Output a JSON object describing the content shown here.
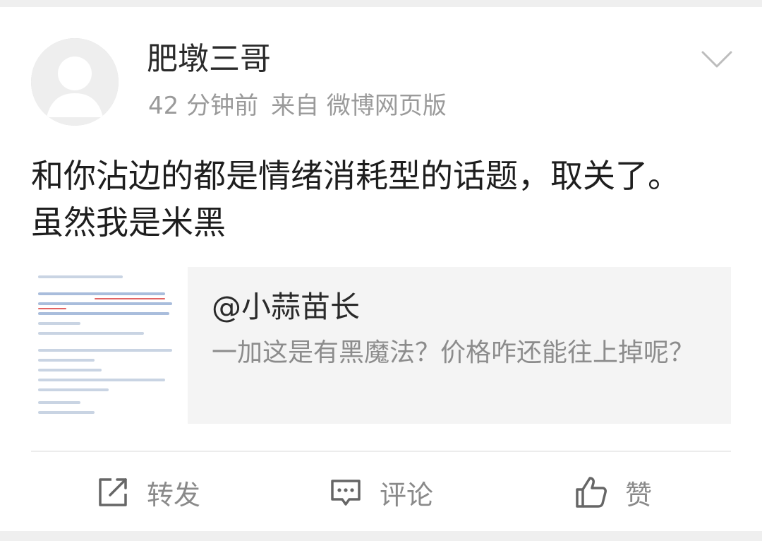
{
  "post": {
    "username": "肥墩三哥",
    "time": "42 分钟前",
    "source": "来自 微博网页版",
    "text": "和你沾边的都是情绪消耗型的话题，取关了。虽然我是米黑"
  },
  "repost": {
    "username": "@小蒜苗长",
    "text": "一加这是有黑魔法？价格咋还能往上掉呢？"
  },
  "actions": {
    "forward_label": "转发",
    "comment_label": "评论",
    "like_label": "赞"
  },
  "icons": {
    "avatar": "default-avatar-icon",
    "menu": "chevron-down-icon",
    "forward": "share-arrow-icon",
    "comment": "comment-bubble-icon",
    "like": "thumbs-up-icon"
  },
  "colors": {
    "page_background": "#efefef",
    "card_background": "#ffffff",
    "repost_background": "#f4f4f4",
    "secondary_text": "#9a9a9a"
  }
}
